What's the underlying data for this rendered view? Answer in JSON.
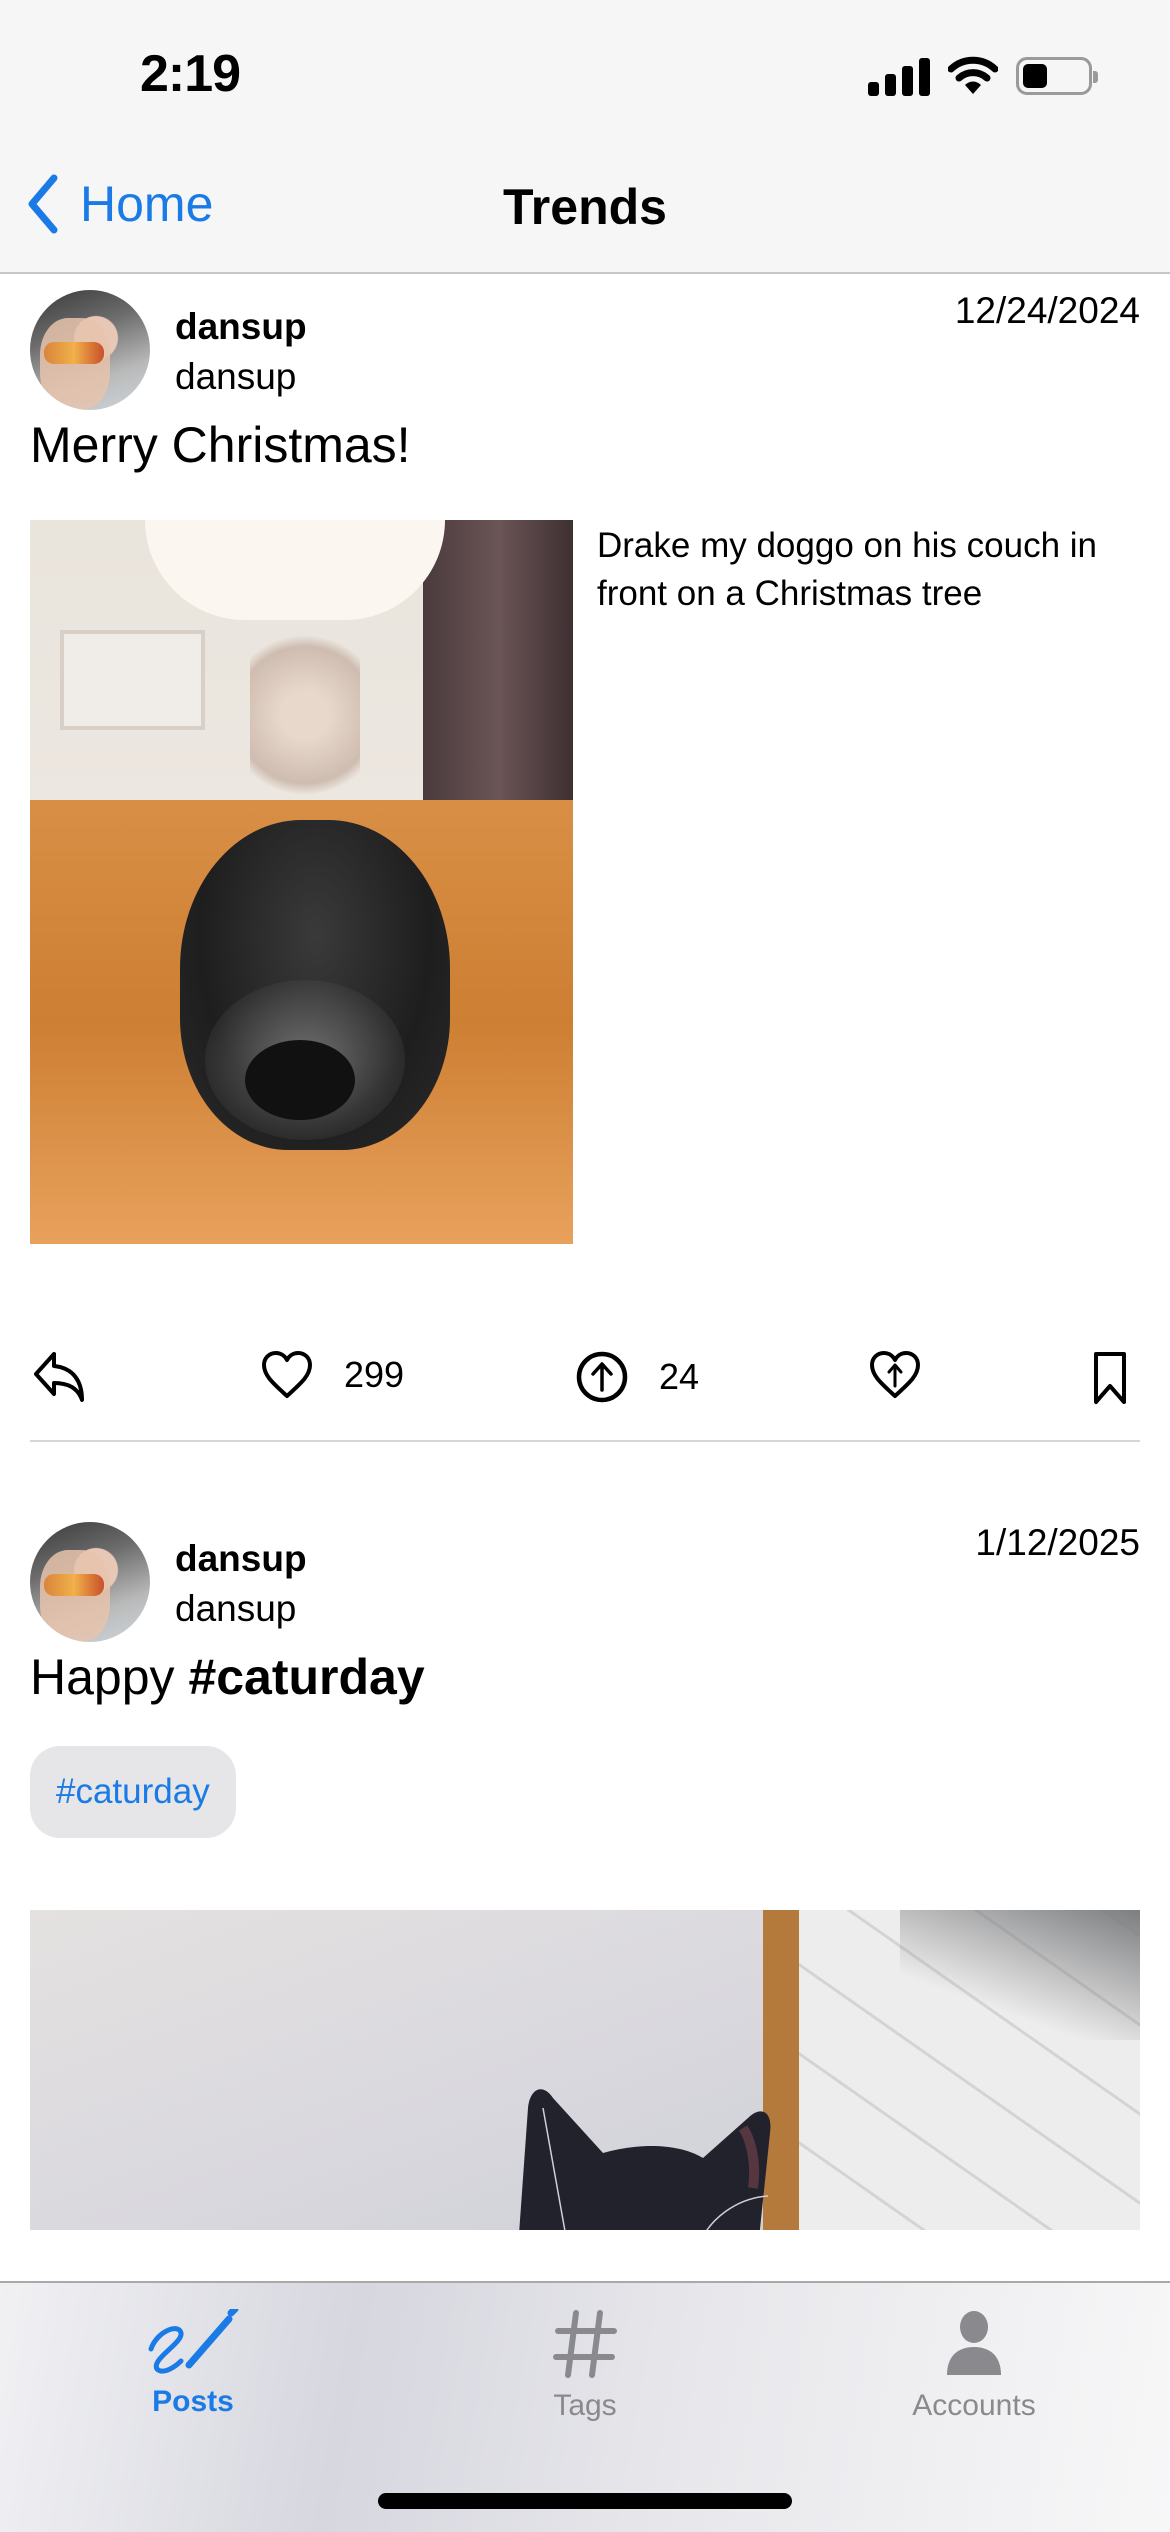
{
  "status_bar": {
    "time": "2:19",
    "icons": [
      "cellular-signal-icon",
      "wifi-icon",
      "battery-icon"
    ],
    "battery_level_percent": 30
  },
  "nav": {
    "back_label": "Home",
    "back_icon": "chevron-left-icon",
    "title": "Trends"
  },
  "colors": {
    "accent": "#1a7ae6",
    "inactive_tab": "#8a8a8e",
    "chip_bg": "#e6e6e8",
    "divider": "#d6d6d6"
  },
  "posts": [
    {
      "display_name": "dansup",
      "username": "dansup",
      "date": "12/24/2024",
      "text": "Merry Christmas!",
      "media_alt": "Drake my doggo on his couch in front on a Christmas tree",
      "actions": {
        "reply_icon": "reply-icon",
        "like_icon": "heart-icon",
        "like_count": "299",
        "boost_icon": "arrow-up-circle-icon",
        "boost_count": "24",
        "favorite_boost_icon": "heart-arrow-up-icon",
        "bookmark_icon": "bookmark-icon"
      }
    },
    {
      "display_name": "dansup",
      "username": "dansup",
      "date": "1/12/2025",
      "text_prefix": "Happy ",
      "text_hashtag": "#caturday",
      "tags": [
        "#caturday"
      ]
    }
  ],
  "tab_bar": {
    "tabs": [
      {
        "label": "Posts",
        "icon": "pencil-scribble-icon",
        "active": true
      },
      {
        "label": "Tags",
        "icon": "hashtag-icon",
        "active": false
      },
      {
        "label": "Accounts",
        "icon": "person-icon",
        "active": false
      }
    ]
  }
}
